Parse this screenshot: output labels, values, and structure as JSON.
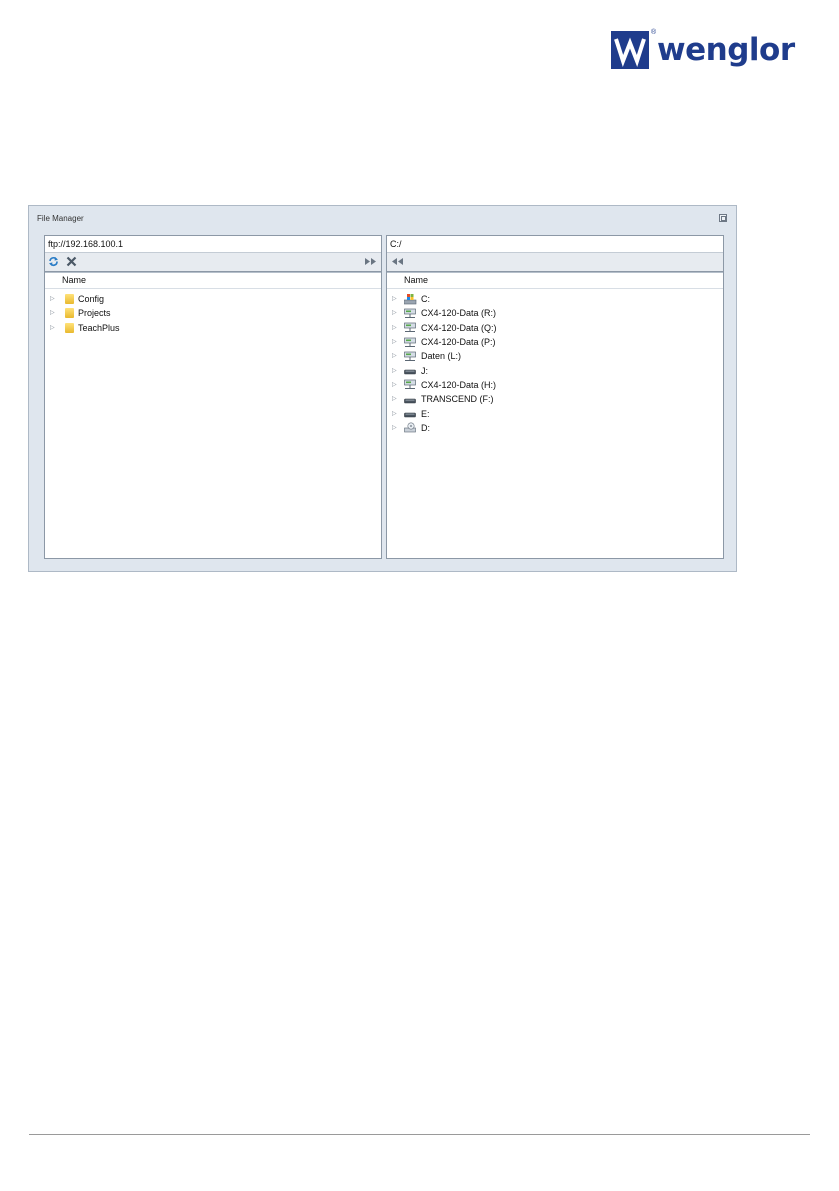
{
  "brand": {
    "name": "wenglor",
    "color": "#1f3c8c"
  },
  "window": {
    "title": "File Manager"
  },
  "left_pane": {
    "path": "ftp://192.168.100.1",
    "column_header": "Name",
    "items": [
      {
        "label": "Config",
        "icon": "folder-icon"
      },
      {
        "label": "Projects",
        "icon": "folder-icon"
      },
      {
        "label": "TeachPlus",
        "icon": "folder-icon"
      }
    ],
    "toolbar": {
      "refresh": "refresh-icon",
      "delete": "delete-icon",
      "transfer": "transfer-right-icon"
    }
  },
  "right_pane": {
    "path": "C:/",
    "column_header": "Name",
    "items": [
      {
        "label": "C:",
        "icon": "system-drive-icon"
      },
      {
        "label": "CX4-120-Data (R:)",
        "icon": "network-drive-icon"
      },
      {
        "label": "CX4-120-Data (Q:)",
        "icon": "network-drive-icon"
      },
      {
        "label": "CX4-120-Data (P:)",
        "icon": "network-drive-icon"
      },
      {
        "label": "Daten (L:)",
        "icon": "network-drive-icon"
      },
      {
        "label": "J:",
        "icon": "removable-drive-icon"
      },
      {
        "label": "CX4-120-Data (H:)",
        "icon": "network-drive-icon"
      },
      {
        "label": "TRANSCEND (F:)",
        "icon": "removable-drive-icon"
      },
      {
        "label": "E:",
        "icon": "removable-drive-icon"
      },
      {
        "label": "D:",
        "icon": "optical-drive-icon"
      }
    ],
    "toolbar": {
      "transfer": "transfer-left-icon"
    }
  }
}
